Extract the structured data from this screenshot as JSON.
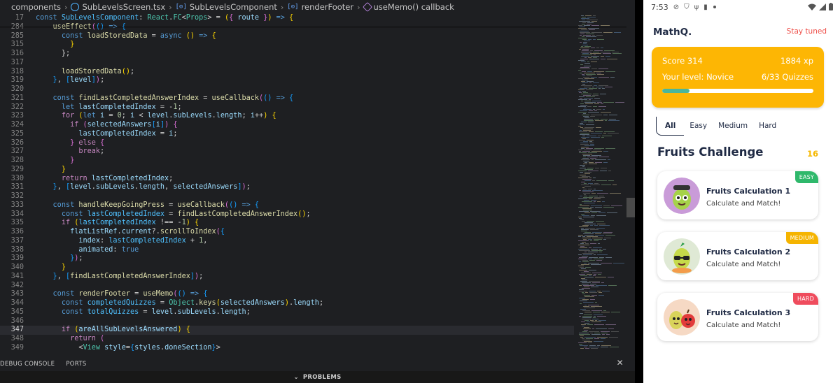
{
  "editor": {
    "breadcrumb": [
      "components",
      "SubLevelsScreen.tsx",
      "SubLevelsComponent",
      "renderFooter",
      "useMemo() callback"
    ],
    "panel_tabs": [
      "DEBUG CONSOLE",
      "PORTS"
    ],
    "panel_close": "✕",
    "problems_label": "PROBLEMS",
    "sticky_lines": [
      {
        "n": "17",
        "html": "<span class='kw'>const</span> <span class='cn'>SubLevelsComponent</span><span class='op'>: </span><span class='ty'>React</span><span class='op'>.</span><span class='ty'>FC</span><span class='op'>&lt;</span><span class='ty'>Props</span><span class='op'>&gt; = </span><span class='b1'>(</span><span class='b2'>{</span> <span class='va'>route</span> <span class='b2'>}</span><span class='b1'>)</span> <span class='kw'>=&gt;</span> <span class='b1'>{</span>"
      },
      {
        "n": "284",
        "html": "    <span class='fn'>useEffect</span><span class='b2'>(</span><span class='b3'>()</span> <span class='kw'>=&gt;</span> <span class='b3'>{</span>"
      },
      {
        "n": "285",
        "html": "      <span class='kw'>const</span> <span class='fn'>loadStoredData</span> <span class='op'>=</span> <span class='kw'>async</span> <span class='b1'>()</span> <span class='kw'>=&gt;</span> <span class='b1'>{</span>"
      }
    ],
    "lines": [
      {
        "n": "315",
        "html": "        <span class='b1'>}</span>"
      },
      {
        "n": "316",
        "html": "      <span class='op'>};</span>"
      },
      {
        "n": "317",
        "html": ""
      },
      {
        "n": "318",
        "html": "      <span class='fn'>loadStoredData</span><span class='b1'>()</span><span class='op'>;</span>"
      },
      {
        "n": "319",
        "html": "    <span class='b3'>}</span><span class='op'>, </span><span class='b3'>[</span><span class='va'>level</span><span class='b3'>]</span><span class='b2'>)</span><span class='op'>;</span>"
      },
      {
        "n": "320",
        "html": ""
      },
      {
        "n": "321",
        "html": "    <span class='kw'>const</span> <span class='fn'>findLastCompletedAnswerIndex</span> <span class='op'>=</span> <span class='fn'>useCallback</span><span class='b2'>(</span><span class='b3'>()</span> <span class='kw'>=&gt;</span> <span class='b3'>{</span>"
      },
      {
        "n": "322",
        "html": "      <span class='kw'>let</span> <span class='va'>lastCompletedIndex</span> <span class='op'>= -</span><span class='nu'>1</span><span class='op'>;</span>"
      },
      {
        "n": "323",
        "html": "      <span class='kc'>for</span> <span class='b1'>(</span><span class='kw'>let</span> <span class='va'>i</span> <span class='op'>=</span> <span class='nu'>0</span><span class='op'>; </span><span class='va'>i</span> <span class='op'>&lt;</span> <span class='va'>level</span><span class='op'>.</span><span class='va'>subLevels</span><span class='op'>.</span><span class='va'>length</span><span class='op'>; </span><span class='va'>i</span><span class='op'>++</span><span class='b1'>)</span> <span class='b1'>{</span>"
      },
      {
        "n": "324",
        "html": "        <span class='kc'>if</span> <span class='b2'>(</span><span class='va'>selectedAnswers</span><span class='b3'>[</span><span class='va'>i</span><span class='b3'>]</span><span class='b2'>)</span> <span class='b2'>{</span>"
      },
      {
        "n": "325",
        "html": "          <span class='va'>lastCompletedIndex</span> <span class='op'>=</span> <span class='va'>i</span><span class='op'>;</span>"
      },
      {
        "n": "326",
        "html": "        <span class='b2'>}</span> <span class='kc'>else</span> <span class='b2'>{</span>"
      },
      {
        "n": "327",
        "html": "          <span class='kc'>break</span><span class='op'>;</span>"
      },
      {
        "n": "328",
        "html": "        <span class='b2'>}</span>"
      },
      {
        "n": "329",
        "html": "      <span class='b1'>}</span>"
      },
      {
        "n": "330",
        "html": "      <span class='kc'>return</span> <span class='va'>lastCompletedIndex</span><span class='op'>;</span>"
      },
      {
        "n": "331",
        "html": "    <span class='b3'>}</span><span class='op'>, </span><span class='b3'>[</span><span class='va'>level</span><span class='op'>.</span><span class='va'>subLevels</span><span class='op'>.</span><span class='va'>length</span><span class='op'>, </span><span class='va'>selectedAnswers</span><span class='b3'>]</span><span class='b2'>)</span><span class='op'>;</span>"
      },
      {
        "n": "332",
        "html": ""
      },
      {
        "n": "333",
        "html": "    <span class='kw'>const</span> <span class='fn'>handleKeepGoingPress</span> <span class='op'>=</span> <span class='fn'>useCallback</span><span class='b2'>(</span><span class='b3'>()</span> <span class='kw'>=&gt;</span> <span class='b3'>{</span>"
      },
      {
        "n": "334",
        "html": "      <span class='kw'>const</span> <span class='cn'>lastCompletedIndex</span> <span class='op'>=</span> <span class='fn'>findLastCompletedAnswerIndex</span><span class='b1'>()</span><span class='op'>;</span>"
      },
      {
        "n": "335",
        "html": "      <span class='kc'>if</span> <span class='b1'>(</span><span class='cn'>lastCompletedIndex</span> <span class='op'>!== -</span><span class='nu'>1</span><span class='b1'>)</span> <span class='b1'>{</span>"
      },
      {
        "n": "336",
        "html": "        <span class='va'>flatListRef</span><span class='op'>.</span><span class='va'>current</span><span class='op'>?.</span><span class='fn'>scrollToIndex</span><span class='b2'>(</span><span class='b3'>{</span>"
      },
      {
        "n": "337",
        "html": "          <span class='va'>index</span><span class='op'>: </span><span class='cn'>lastCompletedIndex</span> <span class='op'>+</span> <span class='nu'>1</span><span class='op'>,</span>"
      },
      {
        "n": "338",
        "html": "          <span class='va'>animated</span><span class='op'>: </span><span class='kw'>true</span>"
      },
      {
        "n": "339",
        "html": "        <span class='b3'>}</span><span class='b2'>)</span><span class='op'>;</span>"
      },
      {
        "n": "340",
        "html": "      <span class='b1'>}</span>"
      },
      {
        "n": "341",
        "html": "    <span class='b3'>}</span><span class='op'>, </span><span class='b3'>[</span><span class='fn'>findLastCompletedAnswerIndex</span><span class='b3'>]</span><span class='b2'>)</span><span class='op'>;</span>"
      },
      {
        "n": "342",
        "html": ""
      },
      {
        "n": "343",
        "html": "    <span class='kw'>const</span> <span class='fn'>renderFooter</span> <span class='op'>=</span> <span class='fn'>useMemo</span><span class='b2'>(</span><span class='b3'>()</span> <span class='kw'>=&gt;</span> <span class='b3'>{</span>"
      },
      {
        "n": "344",
        "html": "      <span class='kw'>const</span> <span class='cn'>completedQuizzes</span> <span class='op'>=</span> <span class='ty'>Object</span><span class='op'>.</span><span class='fn'>keys</span><span class='b1'>(</span><span class='va'>selectedAnswers</span><span class='b1'>)</span><span class='op'>.</span><span class='va'>length</span><span class='op'>;</span>"
      },
      {
        "n": "345",
        "html": "      <span class='kw'>const</span> <span class='cn'>totalQuizzes</span> <span class='op'>=</span> <span class='va'>level</span><span class='op'>.</span><span class='va'>subLevels</span><span class='op'>.</span><span class='va'>length</span><span class='op'>;</span>"
      },
      {
        "n": "346",
        "html": ""
      },
      {
        "n": "347",
        "html": "      <span class='kc'>if</span> <span class='b1'>(</span><span class='va'>areAllSubLevelsAnswered</span><span class='b1'>)</span> <span class='b1'>{</span>",
        "current": true
      },
      {
        "n": "348",
        "html": "        <span class='kc'>return</span> <span class='b2'>(</span>"
      },
      {
        "n": "349",
        "html": "          <span class='op'>&lt;</span><span class='tg'>View</span> <span class='at'>style</span><span class='op'>=</span><span class='b3'>{</span><span class='va'>styles</span><span class='op'>.</span><span class='va'>doneSection</span><span class='b3'>}</span><span class='op'>&gt;</span>"
      }
    ]
  },
  "phone": {
    "status": {
      "time": "7:53"
    },
    "app_title": "MathQ.",
    "stay_tuned": "Stay tuned",
    "score_label": "Score 314",
    "xp": "1884 xp",
    "level_label": "Your level: Novice",
    "quizzes": "6/33 Quizzes",
    "progress_fraction": 0.18,
    "tabs": [
      "All",
      "Easy",
      "Medium",
      "Hard"
    ],
    "active_tab": "All",
    "section_title": "Fruits Challenge",
    "section_count": "16",
    "cards": [
      {
        "title": "Fruits Calculation 1",
        "subtitle": "Calculate and Match!",
        "badge": "EASY",
        "badge_color": "#2fb86b"
      },
      {
        "title": "Fruits Calculation 2",
        "subtitle": "Calculate and Match!",
        "badge": "MEDIUM",
        "badge_color": "#f5b400"
      },
      {
        "title": "Fruits Calculation 3",
        "subtitle": "Calculate and Match!",
        "badge": "HARD",
        "badge_color": "#ef4c5d"
      }
    ],
    "colors": {
      "accent": "#fdb604",
      "progress": "#4bb69a",
      "stay_tuned": "#ee4d47"
    }
  }
}
